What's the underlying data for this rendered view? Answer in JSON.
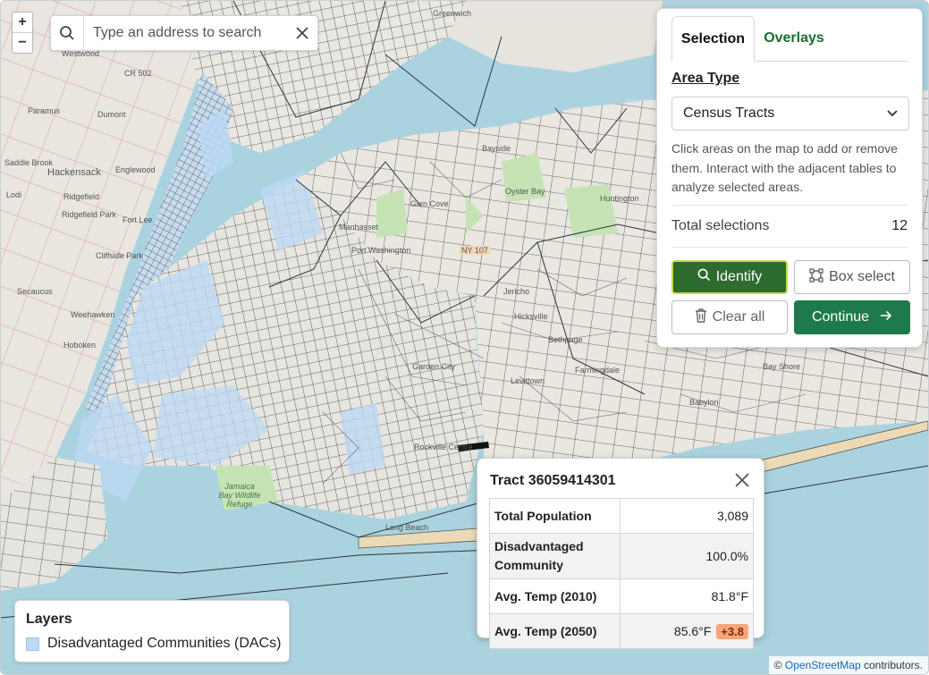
{
  "search": {
    "placeholder": "Type an address to search"
  },
  "zoom": {
    "in_label": "+",
    "out_label": "−"
  },
  "map_labels": [
    "Greenwich",
    "Westwood",
    "CR 502",
    "Paramus",
    "Dumont",
    "Saddle Brook",
    "Hackensack",
    "Englewood",
    "Lodi",
    "Ridgefield",
    "Fort Lee",
    "Ridgefield Park",
    "Cliffside Park",
    "Secaucus",
    "Weehawken",
    "Hoboken",
    "Bayside",
    "Port Washington",
    "Manhasset",
    "Glen Cove",
    "Oyster Bay",
    "Huntington",
    "Hicksville",
    "Bethpage",
    "Farmingdale",
    "Levittown",
    "Garden City",
    "Rockville Centre",
    "Long Beach",
    "Jamaica Bay Wildlife Refuge",
    "Bay Shore",
    "Babylon",
    "NY 107",
    "Jericho"
  ],
  "panel": {
    "tabs": [
      {
        "label": "Selection",
        "active": true
      },
      {
        "label": "Overlays",
        "active": false
      }
    ],
    "area_type_label": "Area Type",
    "area_type_value": "Census Tracts",
    "help_text": "Click areas on the map to add or remove them. Interact with the adjacent tables to analyze selected areas.",
    "total_label": "Total selections",
    "total_value": "12",
    "buttons": {
      "identify": "Identify",
      "box_select": "Box select",
      "clear_all": "Clear all",
      "continue": "Continue"
    }
  },
  "popup": {
    "title": "Tract 36059414301",
    "rows": [
      {
        "label": "Total Population",
        "value": "3,089"
      },
      {
        "label": "Disadvantaged Community",
        "value": "100.0%"
      },
      {
        "label": "Avg. Temp (2010)",
        "value": "81.8°F"
      },
      {
        "label": "Avg. Temp (2050)",
        "value": "85.6°F",
        "delta": "+3.8"
      }
    ]
  },
  "layers": {
    "title": "Layers",
    "items": [
      {
        "label": "Disadvantaged Communities (DACs)",
        "color": "#bcd8f4"
      }
    ]
  },
  "attribution": {
    "prefix": "©",
    "link": "OpenStreetMap",
    "suffix": "contributors."
  },
  "colors": {
    "water": "#aad3df",
    "land": "#ecebe6",
    "dac": "#bcd8f4",
    "accent_green": "#2e6b2f",
    "continue": "#1e7a4d",
    "delta_badge": "#f7a57a"
  }
}
